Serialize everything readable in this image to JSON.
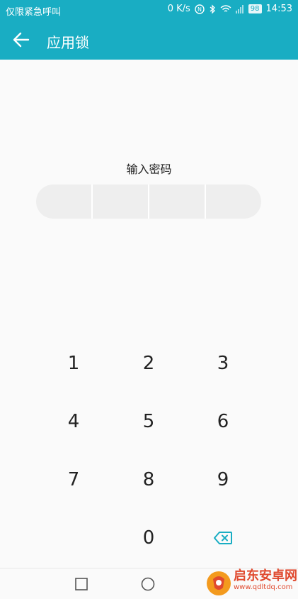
{
  "status_bar": {
    "carrier": "仅限紧急呼叫",
    "speed": "0 K/s",
    "battery": "98",
    "time": "14:53"
  },
  "app_bar": {
    "title": "应用锁"
  },
  "prompt": "输入密码",
  "keypad": {
    "keys": [
      "1",
      "2",
      "3",
      "4",
      "5",
      "6",
      "7",
      "8",
      "9",
      "0"
    ]
  },
  "watermark": {
    "name": "启东安卓网",
    "url": "www.qdltdq.com"
  },
  "colors": {
    "accent": "#19adc3",
    "background": "#fafafa",
    "pin_box": "#eeeeee"
  },
  "icons": {
    "back": "arrow-left-icon",
    "delete": "backspace-icon",
    "recent": "square-icon",
    "home": "circle-icon"
  }
}
